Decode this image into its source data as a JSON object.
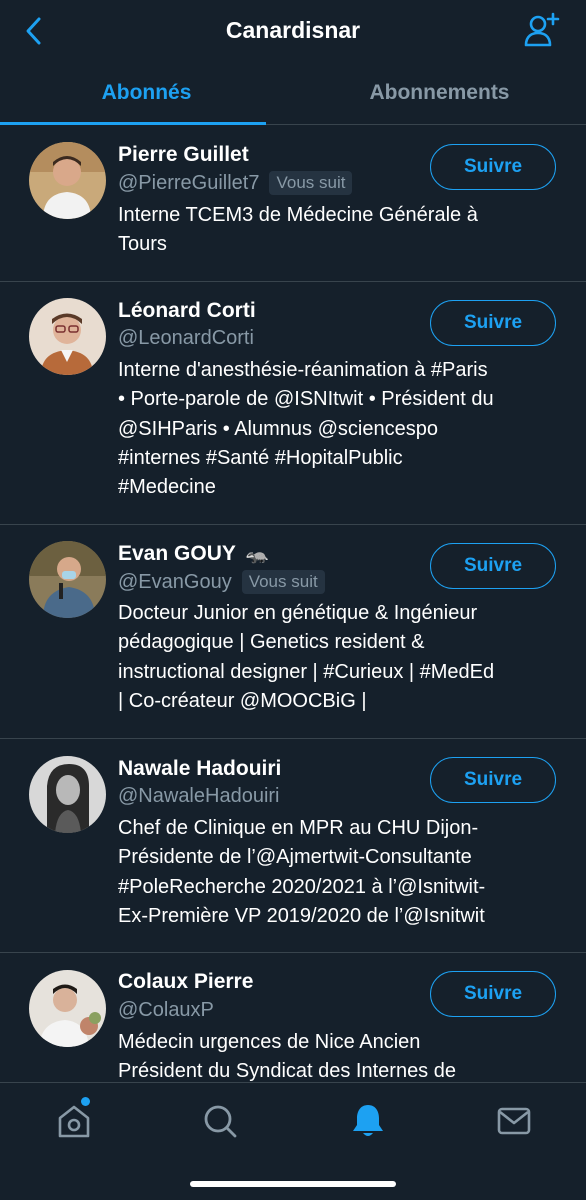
{
  "header": {
    "title": "Canardisnar"
  },
  "tabs": [
    {
      "label": "Abonnés",
      "active": true
    },
    {
      "label": "Abonnements",
      "active": false
    }
  ],
  "users": [
    {
      "name": "Pierre Guillet",
      "handle": "@PierreGuillet7",
      "follows_you": "Vous suit",
      "bio": [
        "Interne TCEM3 de Médecine Générale à",
        "Tours"
      ],
      "button": "Suivre"
    },
    {
      "name": "Léonard Corti",
      "handle": "@LeonardCorti",
      "bio": [
        "Interne d'anesthésie-réanimation à #Paris",
        "• Porte-parole de @ISNItwit • Président du",
        "@SIHParis • Alumnus @sciencespo",
        "#internes #Santé #HopitalPublic",
        "#Medecine"
      ],
      "button": "Suivre"
    },
    {
      "name": "Evan GOUY",
      "name_emoji": "🦡",
      "handle": "@EvanGouy",
      "follows_you": "Vous suit",
      "bio": [
        "Docteur Junior en génétique & Ingénieur",
        "pédagogique | Genetics resident &",
        "instructional designer | #Curieux | #MedEd",
        "| Co-créateur @MOOCBiG |"
      ],
      "button": "Suivre"
    },
    {
      "name": "Nawale Hadouiri",
      "handle": "@NawaleHadouiri",
      "bio": [
        "Chef de Clinique en MPR au CHU Dijon-",
        "Présidente de l’@Ajmertwit-Consultante",
        "#PoleRecherche 2020/2021 à l’@Isnitwit-",
        "Ex-Première VP 2019/2020 de l’@Isnitwit"
      ],
      "button": "Suivre"
    },
    {
      "name": "Colaux Pierre",
      "handle": "@ColauxP",
      "bio": [
        "Médecin urgences de Nice Ancien",
        "Président du Syndicat des Internes de"
      ],
      "button": "Suivre"
    }
  ],
  "bottom_nav": [
    {
      "icon": "home-icon",
      "has_dot": true
    },
    {
      "icon": "search-icon"
    },
    {
      "icon": "bell-icon",
      "active": true
    },
    {
      "icon": "mail-icon"
    }
  ],
  "colors": {
    "background": "#15202b",
    "accent": "#1da1f2",
    "secondary_text": "#8899a6",
    "divider": "#38444d"
  }
}
